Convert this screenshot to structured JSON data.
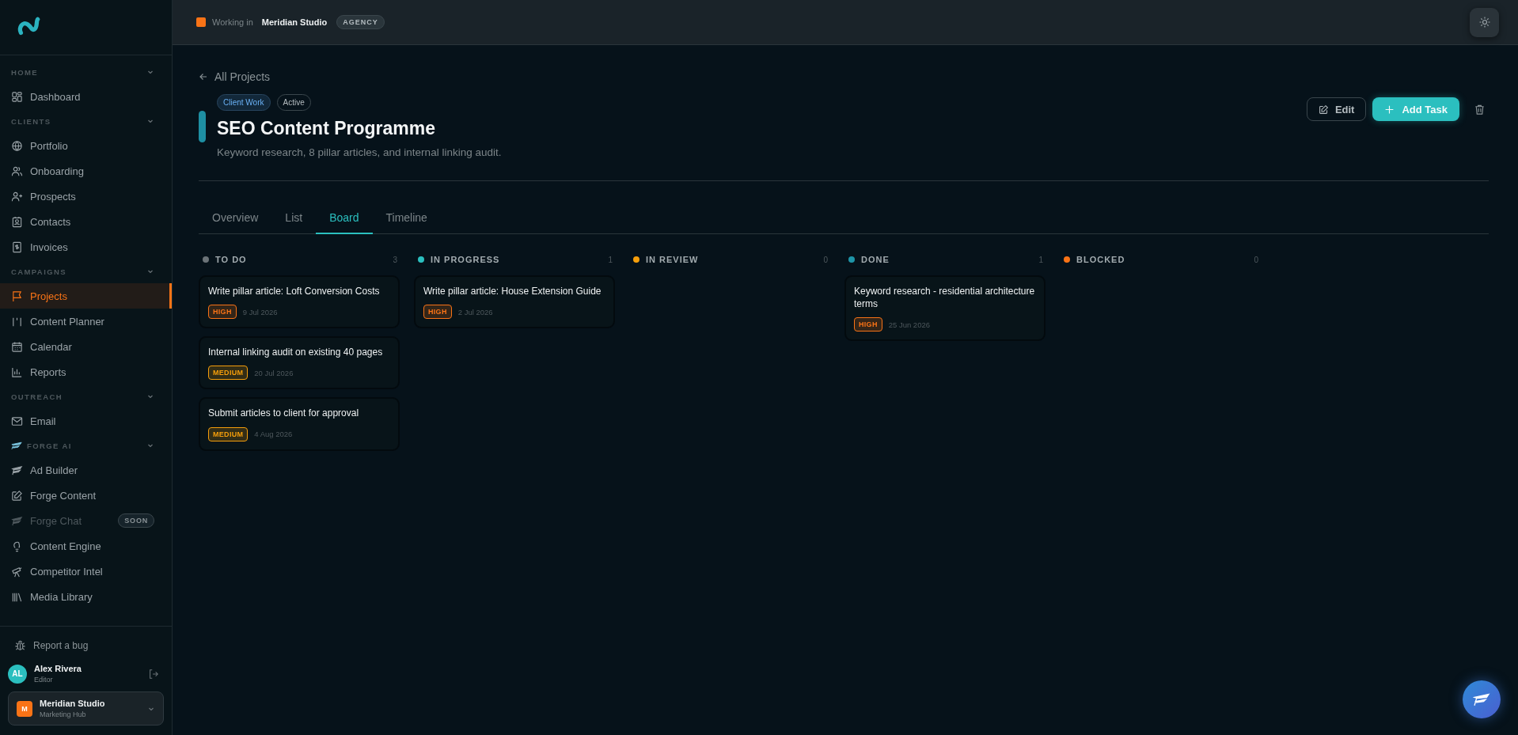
{
  "sidebar": {
    "sections": [
      {
        "label": "HOME",
        "expanded": true,
        "items": [
          {
            "label": "Dashboard",
            "selected": false
          }
        ]
      },
      {
        "label": "CLIENTS",
        "expanded": true,
        "items": [
          {
            "label": "Portfolio",
            "selected": false
          },
          {
            "label": "Onboarding",
            "selected": false
          },
          {
            "label": "Prospects",
            "selected": false
          },
          {
            "label": "Contacts",
            "selected": false
          },
          {
            "label": "Invoices",
            "selected": false
          }
        ]
      },
      {
        "label": "CAMPAIGNS",
        "expanded": true,
        "items": [
          {
            "label": "Projects",
            "selected": true
          },
          {
            "label": "Content Planner",
            "selected": false
          },
          {
            "label": "Calendar",
            "selected": false
          },
          {
            "label": "Reports",
            "selected": false
          }
        ]
      },
      {
        "label": "OUTREACH",
        "expanded": true,
        "items": [
          {
            "label": "Email",
            "selected": false
          }
        ]
      },
      {
        "label": "FORGE AI",
        "expanded": true,
        "items": [
          {
            "label": "Ad Builder",
            "selected": false,
            "disabled": false
          },
          {
            "label": "Forge Content",
            "selected": false,
            "disabled": false
          },
          {
            "label": "Forge Chat",
            "selected": false,
            "disabled": true,
            "badge": "SOON"
          },
          {
            "label": "Content Engine",
            "selected": false,
            "disabled": false
          },
          {
            "label": "Competitor Intel",
            "selected": false,
            "disabled": false
          },
          {
            "label": "Media Library",
            "selected": false,
            "disabled": false
          }
        ]
      }
    ],
    "report_bug": "Report a bug",
    "user": {
      "initials": "AL",
      "name": "Alex Rivera",
      "role": "Editor"
    },
    "workspace": {
      "initial": "M",
      "name": "Meridian Studio",
      "subtitle": "Marketing Hub"
    }
  },
  "header": {
    "working_in": "Working in",
    "workspace": "Meridian Studio",
    "badge": "AGENCY"
  },
  "project": {
    "back": "All Projects",
    "tags": [
      {
        "label": "Client Work",
        "kind": "category"
      },
      {
        "label": "Active",
        "kind": "status"
      }
    ],
    "title": "SEO Content Programme",
    "description": "Keyword research, 8 pillar articles, and internal linking audit.",
    "buttons": {
      "edit": "Edit",
      "add": "Add Task"
    }
  },
  "tabs": [
    {
      "label": "Overview",
      "selected": false
    },
    {
      "label": "List",
      "selected": false
    },
    {
      "label": "Board",
      "selected": true
    },
    {
      "label": "Timeline",
      "selected": false
    }
  ],
  "columns": [
    {
      "title": "TO DO",
      "count": "3",
      "color": "#6b7378",
      "cards": [
        {
          "title": "Write pillar article: Loft Conversion Costs",
          "priority": "HIGH",
          "color": "#f97316",
          "date": "9 Jul 2026"
        },
        {
          "title": "Internal linking audit on existing 40 pages",
          "priority": "MEDIUM",
          "color": "#f59e0b",
          "date": "20 Jul 2026"
        },
        {
          "title": "Submit articles to client for approval",
          "priority": "MEDIUM",
          "color": "#f59e0b",
          "date": "4 Aug 2026"
        }
      ]
    },
    {
      "title": "IN PROGRESS",
      "count": "1",
      "color": "#2bbfbf",
      "cards": [
        {
          "title": "Write pillar article: House Extension Guide",
          "priority": "HIGH",
          "color": "#f97316",
          "date": "2 Jul 2026"
        }
      ]
    },
    {
      "title": "IN REVIEW",
      "count": "0",
      "color": "#f59e0b"
    },
    {
      "title": "DONE",
      "count": "1",
      "color": "#1e95a8",
      "cards": [
        {
          "title": "Keyword research - residential architecture terms",
          "priority": "HIGH",
          "color": "#f97316",
          "date": "25 Jun 2026"
        }
      ]
    },
    {
      "title": "BLOCKED",
      "count": "0",
      "color": "#f97316"
    }
  ]
}
